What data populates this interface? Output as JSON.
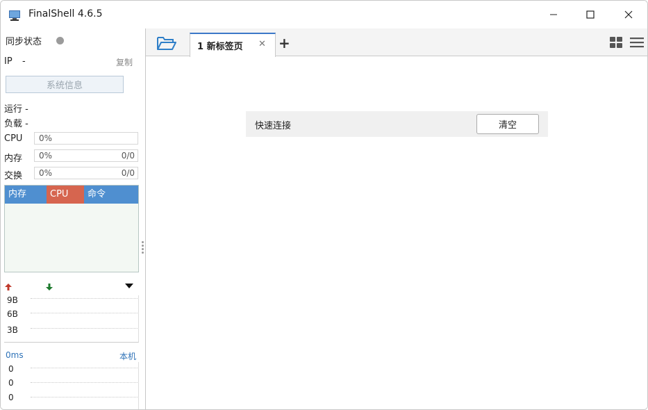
{
  "window": {
    "title": "FinalShell 4.6.5"
  },
  "sidebar": {
    "sync_label": "同步状态",
    "ip_label": "IP",
    "ip_value": "-",
    "copy_label": "复制",
    "sysinfo_button": "系统信息",
    "run_label": "运行 -",
    "load_label": "负载 -",
    "meters": [
      {
        "label": "CPU",
        "percent": "0%",
        "value": ""
      },
      {
        "label": "内存",
        "percent": "0%",
        "value": "0/0"
      },
      {
        "label": "交换",
        "percent": "0%",
        "value": "0/0"
      }
    ],
    "process_columns": [
      "内存",
      "CPU",
      "命令"
    ],
    "network_ticks": [
      "9B",
      "6B",
      "3B"
    ],
    "ping_label": "0ms",
    "ping_host": "本机",
    "ping_ticks": [
      "0",
      "0",
      "0"
    ]
  },
  "tabs": [
    {
      "label": "1 新标签页"
    }
  ],
  "quick_connect": {
    "label": "快速连接",
    "clear_button": "清空"
  },
  "colors": {
    "accent_blue": "#4f8fd0",
    "cpu_red": "#d6654f",
    "tab_accent": "#3c78c8",
    "up_arrow": "#c0392b",
    "down_arrow": "#1e7a2e"
  },
  "icons": {
    "app": "terminal-icon",
    "folder": "folder-open-icon",
    "add_tab": "plus-icon",
    "grid": "grid-view-icon",
    "menu": "hamburger-menu-icon"
  }
}
